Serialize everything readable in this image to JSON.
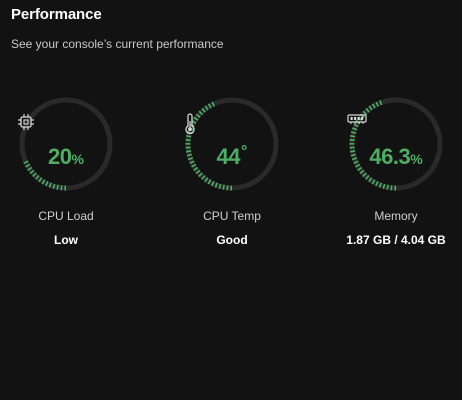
{
  "header": {
    "title": "Performance",
    "subtitle": "See your console’s current performance"
  },
  "colors": {
    "background": "#121212",
    "track": "#2a2a2a",
    "accent": "#4caf63",
    "text_primary": "#ffffff",
    "text_secondary": "#cfcfcf"
  },
  "metrics": [
    {
      "label": "CPU Load",
      "value": "20",
      "unit": "%",
      "status": "Low",
      "icon": "cpu-chip-icon",
      "fill_fraction": 0.2
    },
    {
      "label": "CPU Temp",
      "value": "44",
      "unit": "°",
      "status": "Good",
      "icon": "thermometer-icon",
      "fill_fraction": 0.44
    },
    {
      "label": "Memory",
      "value": "46.3",
      "unit": "%",
      "status": "1.87 GB / 4.04 GB",
      "icon": "memory-module-icon",
      "fill_fraction": 0.463
    }
  ]
}
